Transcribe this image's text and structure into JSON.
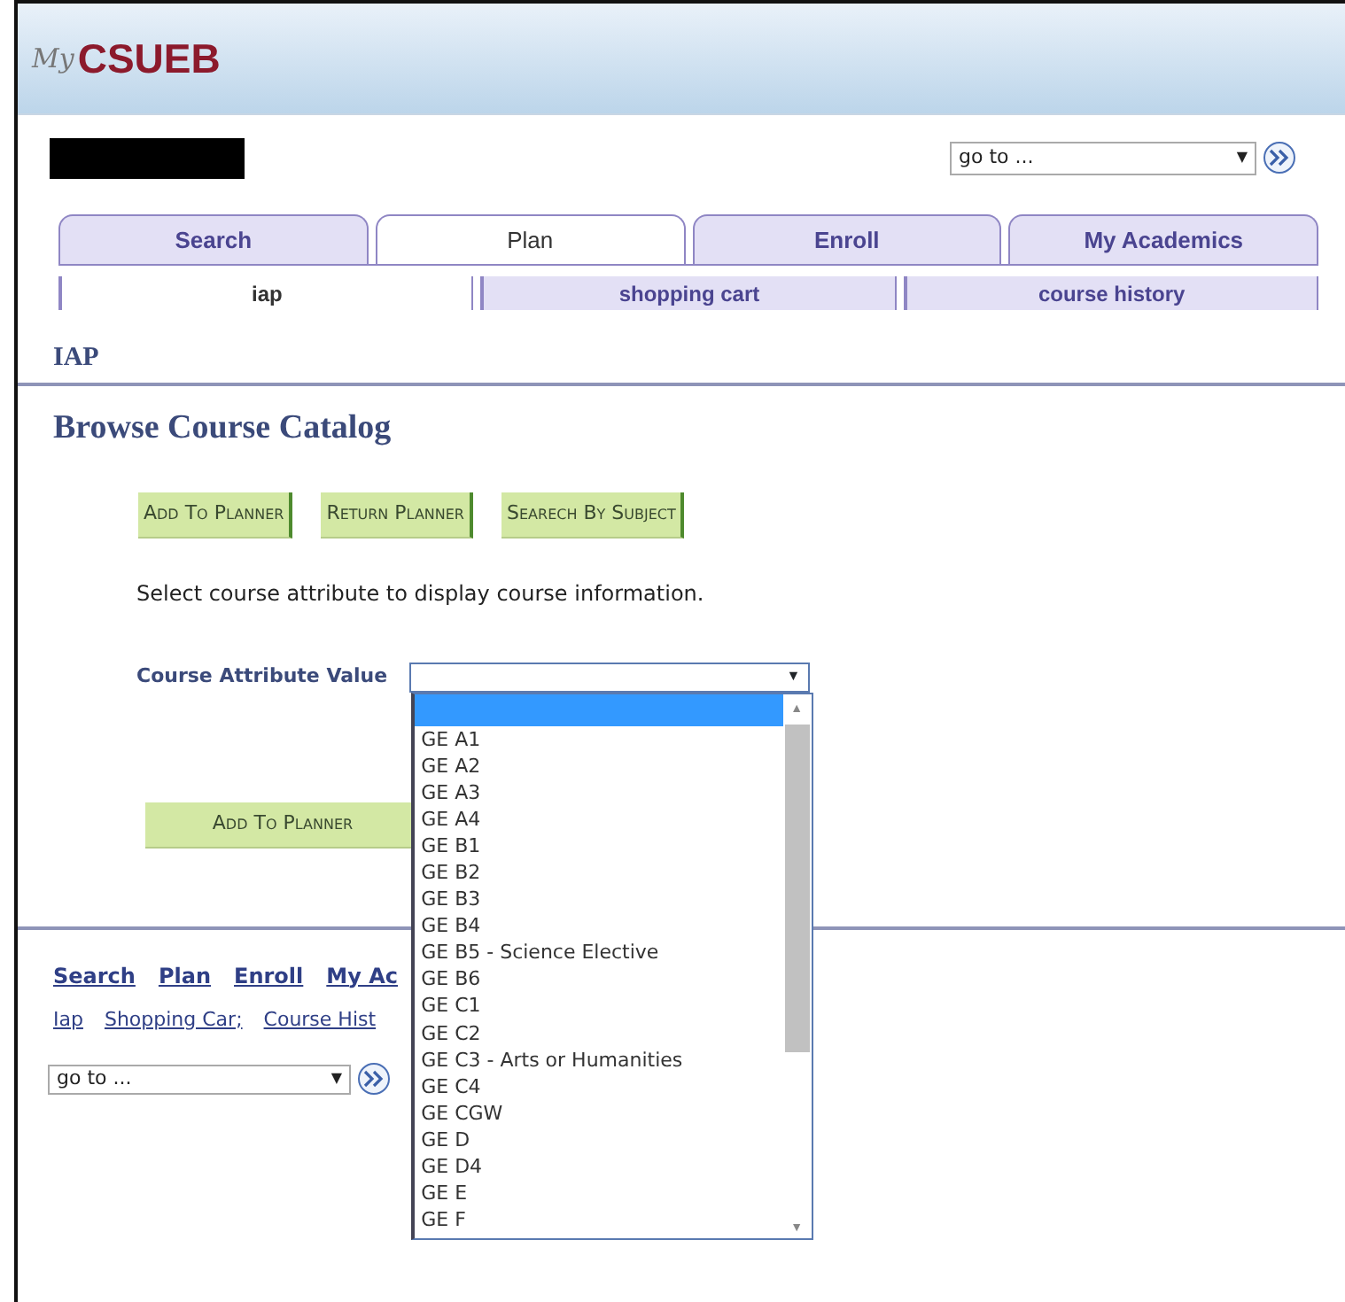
{
  "header": {
    "logo_prefix": "My",
    "logo": "CSUEB"
  },
  "goto_top": {
    "value": "go to ...",
    "arrow": "▼"
  },
  "tabs": [
    {
      "label": "Search",
      "selected": false
    },
    {
      "label": "Plan",
      "selected": true
    },
    {
      "label": "Enroll",
      "selected": false
    },
    {
      "label": "My Academics",
      "selected": false
    }
  ],
  "subtabs": [
    {
      "label": "iap",
      "selected": true
    },
    {
      "label": "shopping cart",
      "selected": false
    },
    {
      "label": "course history",
      "selected": false
    }
  ],
  "section_title": "IAP",
  "page_title": "Browse Course Catalog",
  "buttons": [
    "Add To Planner",
    "Return Planner",
    "Searech By Subject"
  ],
  "instruction": "Select course attribute to display course information.",
  "attribute_field": {
    "label": "Course Attribute Value",
    "arrow": "▼",
    "open": true,
    "blank_highlighted": true,
    "options": [
      {
        "label": "GE A1",
        "selected": false
      },
      {
        "label": "GE A2",
        "selected": false
      },
      {
        "label": "GE A3",
        "selected": false
      },
      {
        "label": "GE A4",
        "selected": false
      },
      {
        "label": "GE B1",
        "selected": false
      },
      {
        "label": "GE B2",
        "selected": false
      },
      {
        "label": "GE B3",
        "selected": false
      },
      {
        "label": "GE B4",
        "selected": false
      },
      {
        "label": "GE B5 - Science Elective",
        "selected": false
      },
      {
        "label": "GE B6",
        "selected": false
      },
      {
        "label": "GE C1",
        "selected": false
      },
      {
        "label": "GE C2",
        "selected": false
      },
      {
        "label": "GE C3 - Arts or Humanities",
        "selected": false
      },
      {
        "label": "GE C4",
        "selected": false
      },
      {
        "label": "GE CGW",
        "selected": false
      },
      {
        "label": "GE D",
        "selected": false
      },
      {
        "label": "GE D4",
        "selected": false
      },
      {
        "label": "GE E",
        "selected": false
      },
      {
        "label": "GE F",
        "selected": false
      }
    ],
    "scroll_up": "▲",
    "scroll_down": "▼"
  },
  "bottom_button": "Add To Planner",
  "footer_links": [
    "Search",
    "Plan",
    "Enroll",
    "My Ac"
  ],
  "footer_sublinks": [
    "Iap",
    "Shopping Car;",
    "Course Hist"
  ],
  "goto_bottom": {
    "value": "go to ...",
    "arrow": "▼"
  }
}
